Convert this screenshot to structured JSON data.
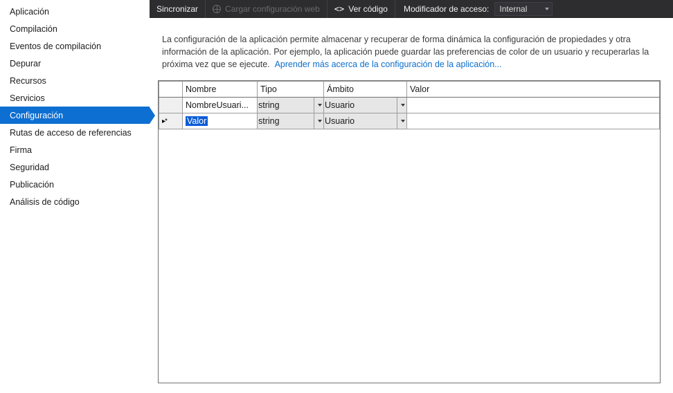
{
  "sidebar": {
    "items": [
      {
        "label": "Aplicación"
      },
      {
        "label": "Compilación"
      },
      {
        "label": "Eventos de compilación"
      },
      {
        "label": "Depurar"
      },
      {
        "label": "Recursos"
      },
      {
        "label": "Servicios"
      },
      {
        "label": "Configuración"
      },
      {
        "label": "Rutas de acceso de referencias"
      },
      {
        "label": "Firma"
      },
      {
        "label": "Seguridad"
      },
      {
        "label": "Publicación"
      },
      {
        "label": "Análisis de código"
      }
    ],
    "active_index": 6
  },
  "toolbar": {
    "sync": "Sincronizar",
    "load_web": "Cargar configuración web",
    "view_code": "Ver código",
    "access_modifier_label": "Modificador de acceso:",
    "access_modifier_value": "Internal"
  },
  "description": {
    "text": "La configuración de la aplicación permite almacenar y recuperar de forma dinámica la configuración de propiedades y otra información de la aplicación. Por ejemplo, la aplicación puede guardar las preferencias de color de un usuario y recuperarlas la próxima vez que se ejecute.",
    "link": "Aprender más acerca de la configuración de la aplicación..."
  },
  "grid": {
    "headers": {
      "name": "Nombre",
      "type": "Tipo",
      "scope": "Ámbito",
      "value": "Valor"
    },
    "rows": [
      {
        "name": "NombreUsuari...",
        "type": "string",
        "scope": "Usuario",
        "value": ""
      },
      {
        "name": "Valor",
        "type": "string",
        "scope": "Usuario",
        "value": "",
        "editing": true,
        "new_row_marker": true
      }
    ]
  }
}
